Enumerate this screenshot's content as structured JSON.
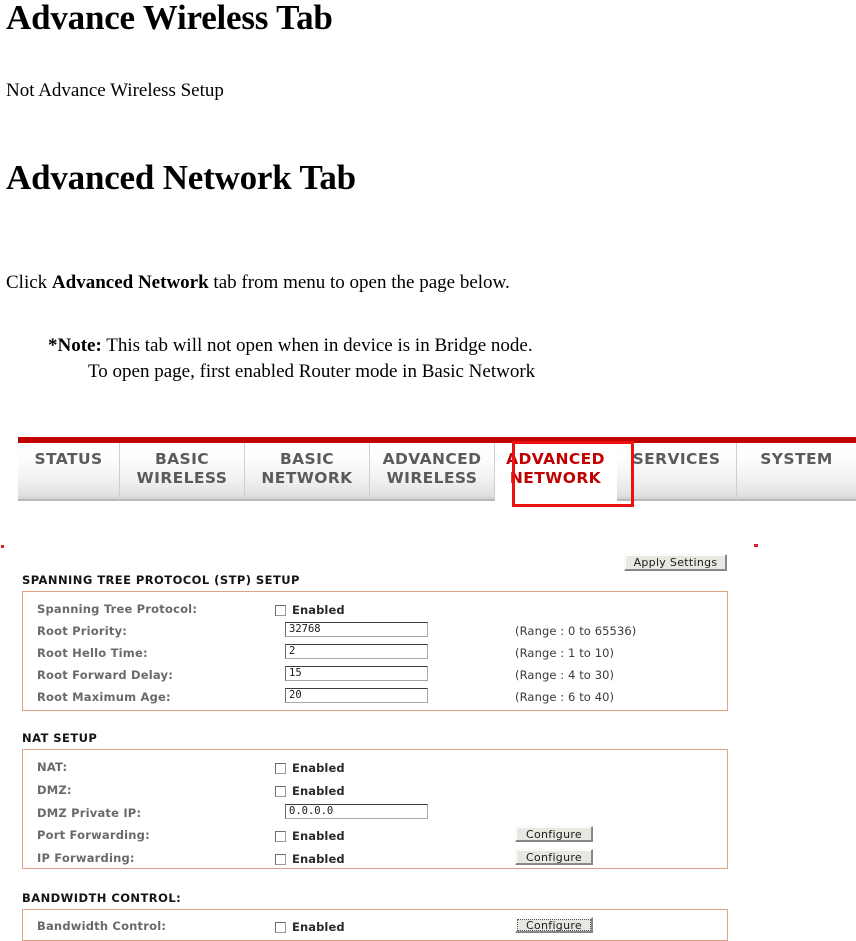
{
  "document": {
    "heading_1": "Advance Wireless Tab",
    "paragraph_1": "Not Advance Wireless Setup",
    "heading_2": "Advanced Network Tab",
    "instruction": {
      "pre": "Click ",
      "bold": "Advanced Network",
      "post": " tab from menu to open the page below."
    },
    "note": {
      "lead": "*Note:",
      "line1": " This tab will not open when in device is in Bridge node.",
      "line2": "To open page, first enabled Router mode in Basic Network"
    }
  },
  "router_ui": {
    "accent_color": "#c00000",
    "active_tab_color": "#ee1111",
    "panel_border_color": "#e0a184",
    "tabs": [
      {
        "label": "STATUS",
        "active": false
      },
      {
        "label": "BASIC\nWIRELESS",
        "active": false
      },
      {
        "label": "BASIC\nNETWORK",
        "active": false
      },
      {
        "label": "ADVANCED\nWIRELESS",
        "active": false
      },
      {
        "label": "ADVANCED\nNETWORK",
        "active": true
      },
      {
        "label": "SERVICES",
        "active": false
      },
      {
        "label": "SYSTEM",
        "active": false
      }
    ],
    "apply_button": "Apply Settings",
    "sections": [
      {
        "title": "SPANNING TREE PROTOCOL (STP) SETUP",
        "rows": [
          {
            "label": "Spanning Tree Protocol:",
            "control": "checkbox",
            "checkbox_label": "Enabled",
            "checked": false
          },
          {
            "label": "Root Priority:",
            "control": "text",
            "value": "32768",
            "hint": "(Range : 0 to 65536)"
          },
          {
            "label": "Root Hello Time:",
            "control": "text",
            "value": "2",
            "hint": "(Range : 1 to 10)"
          },
          {
            "label": "Root Forward Delay:",
            "control": "text",
            "value": "15",
            "hint": "(Range : 4 to 30)"
          },
          {
            "label": "Root Maximum Age:",
            "control": "text",
            "value": "20",
            "hint": "(Range : 6 to 40)"
          }
        ]
      },
      {
        "title": "NAT SETUP",
        "rows": [
          {
            "label": "NAT:",
            "control": "checkbox",
            "checkbox_label": "Enabled",
            "checked": false
          },
          {
            "label": "DMZ:",
            "control": "checkbox",
            "checkbox_label": "Enabled",
            "checked": false
          },
          {
            "label": "DMZ Private IP:",
            "control": "text",
            "value": "0.0.0.0"
          },
          {
            "label": "Port Forwarding:",
            "control": "checkbox",
            "checkbox_label": "Enabled",
            "checked": false,
            "button": "Configure"
          },
          {
            "label": "IP Forwarding:",
            "control": "checkbox",
            "checkbox_label": "Enabled",
            "checked": false,
            "button": "Configure"
          }
        ]
      },
      {
        "title": "BANDWIDTH CONTROL:",
        "rows": [
          {
            "label": "Bandwidth Control:",
            "control": "checkbox",
            "checkbox_label": "Enabled",
            "checked": false,
            "button": "Configure",
            "button_focused": true
          }
        ]
      }
    ]
  }
}
